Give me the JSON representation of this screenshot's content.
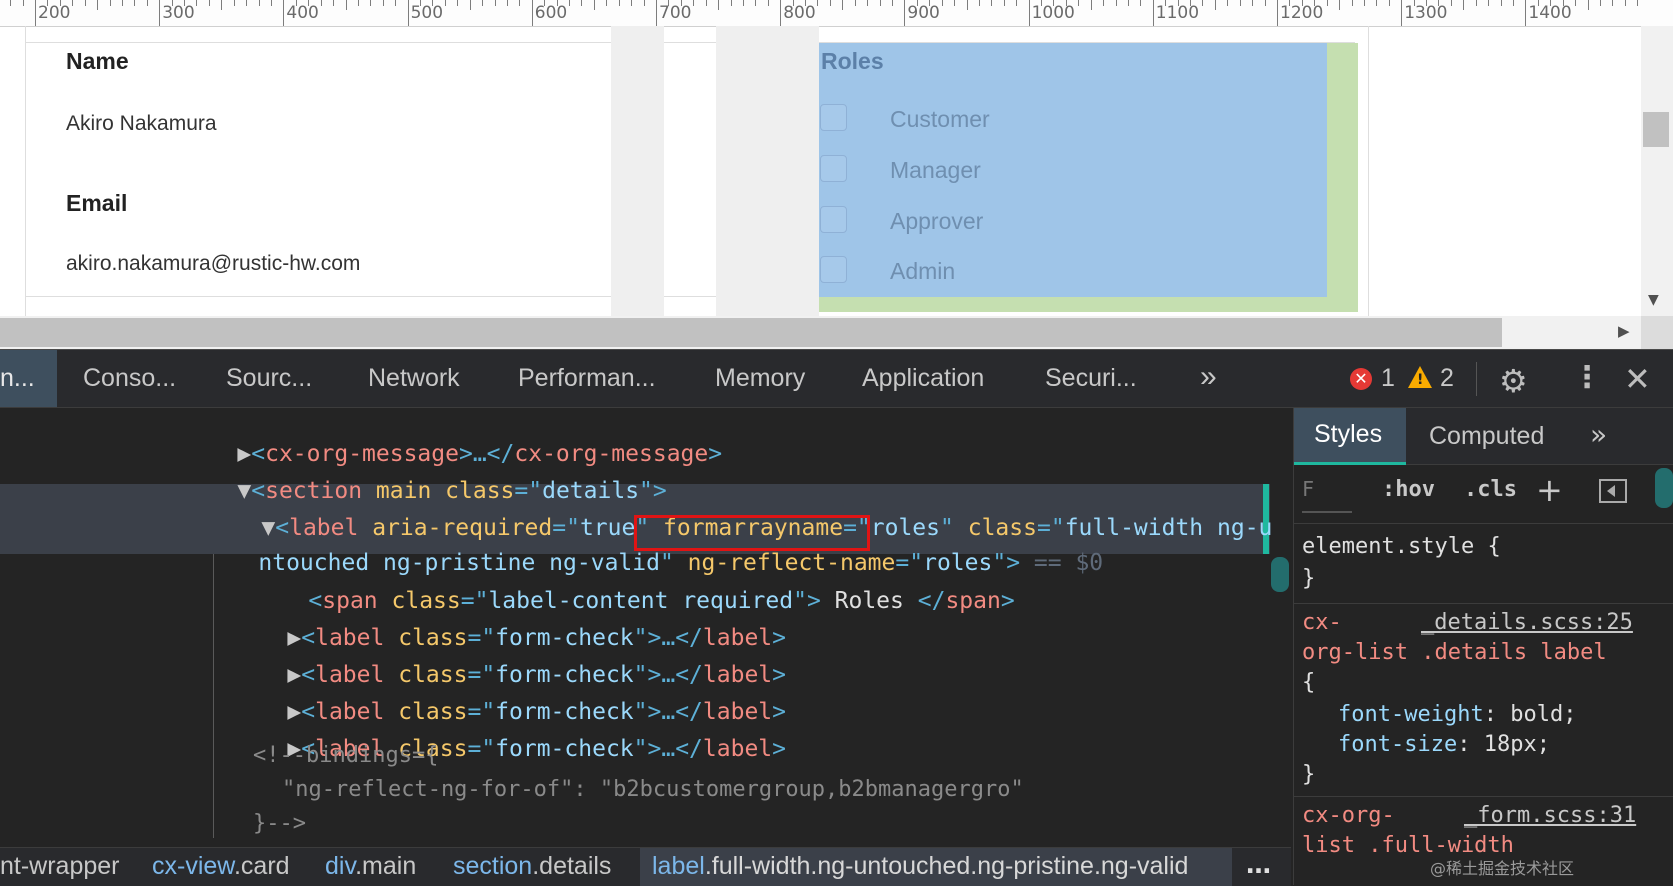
{
  "ruler": {
    "labels": [
      "200",
      "300",
      "400",
      "500",
      "600",
      "700",
      "800",
      "900",
      "1000",
      "1100",
      "1200",
      "1300",
      "1400"
    ]
  },
  "form": {
    "name_label": "Name",
    "name_value": "Akiro Nakamura",
    "email_label": "Email",
    "email_value": "akiro.nakamura@rustic-hw.com",
    "roles_title": "Roles",
    "roles": [
      "Customer",
      "Manager",
      "Approver",
      "Admin"
    ]
  },
  "devtools": {
    "tabs": [
      "n...",
      "Conso...",
      "Sourc...",
      "Network",
      "Performan...",
      "Memory",
      "Application",
      "Securi...",
      "»"
    ],
    "error_count": "1",
    "warning_count": "2",
    "error_icon": "x-circle-icon",
    "warning_icon": "warning-triangle-icon",
    "colors": {
      "accent": "#1fb89f",
      "selection": "#3b4049",
      "highlight_box": "#e01414"
    }
  },
  "dom": {
    "line1": {
      "open": "<",
      "tag": "cx-org-message",
      "close": ">…</",
      "tag2": "cx-org-message",
      "end": ">"
    },
    "line2": {
      "open": "<",
      "tag": "section",
      "attr1": "main",
      "attr2": "class",
      "eq": "=\"",
      "val": "details",
      "end": "\">"
    },
    "line3": {
      "open": "<",
      "tag": "label",
      "a1": "aria-required",
      "v1": "true",
      "a2": "formarrayname",
      "v2": "roles",
      "a3": "class",
      "v3": "full-width ng-u"
    },
    "line4": {
      "v3b": "ntouched ng-pristine ng-valid",
      "a4": "ng-reflect-name",
      "v4": "roles",
      "marker": "== $0"
    },
    "line5": {
      "tag": "span",
      "a": "class",
      "v": "label-content required",
      "text": " Roles ",
      "ctag": "span"
    },
    "formcheck": {
      "tag": "label",
      "a": "class",
      "v": "form-check",
      "mid": ">…</",
      "ctag": "label"
    },
    "comment1": "<!--bindings={",
    "comment2": "\"ng-reflect-ng-for-of\": \"b2bcustomergroup,b2bmanagergro\"",
    "comment3": "}-->"
  },
  "breadcrumbs": [
    {
      "tag": "nt-wrapper",
      "cls": ""
    },
    {
      "tag": "cx-view",
      "cls": ".card"
    },
    {
      "tag": "div",
      "cls": ".main"
    },
    {
      "tag": "section",
      "cls": ".details"
    },
    {
      "tag": "label",
      "cls": ".full-width.ng-untouched.ng-pristine.ng-valid"
    }
  ],
  "breadcrumbs_more": "…",
  "styles": {
    "tab_styles": "Styles",
    "tab_computed": "Computed",
    "tab_more": "»",
    "filter_placeholder": "F",
    "hov": ":hov",
    "cls": ".cls",
    "plus": "+",
    "element_style": "element.style",
    "rule1": {
      "sel_a": "cx-",
      "source": "_details.scss:25",
      "sel_b": "org-list .details label",
      "decls": [
        {
          "prop": "font-weight",
          "val": "bold"
        },
        {
          "prop": "font-size",
          "val": "18px"
        }
      ]
    },
    "rule2": {
      "sel_a": "cx-org-",
      "source": "_form.scss:31",
      "sel_b": "list .full-width"
    }
  },
  "watermark": "@稀土掘金技术社区"
}
